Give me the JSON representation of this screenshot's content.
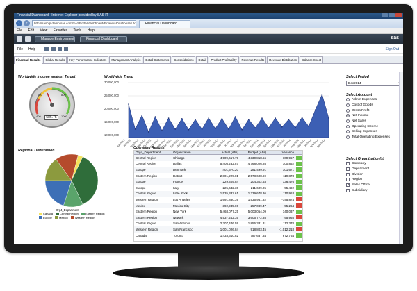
{
  "browser": {
    "title": "Financial Dashboard - Internet Explorer provided by SAS IT",
    "url": "http://sasbip.demo.sas.com/SASPortal/dashboard/FinancialDashboard.do",
    "tab_label": "Financial Dashboard",
    "menu": [
      "File",
      "Edit",
      "View",
      "Favorites",
      "Tools",
      "Help"
    ]
  },
  "sasbar": {
    "env_label": "Manage Environment",
    "dash_label": "Financial Dashboard",
    "logo": "sas"
  },
  "filebar": {
    "file": "File",
    "help": "Help",
    "signout": "Sign Out"
  },
  "tabs": [
    "Financial Results",
    "Global Results",
    "Key Performance Indicators",
    "Management Analysis",
    "Detail Statements",
    "Consolidations",
    "Detail",
    "Product Profitability",
    "Revenue Results",
    "Revenue Distribution",
    "Balance Sheet"
  ],
  "gauge": {
    "title": "Worldwide Income against Target",
    "value": "586.75",
    "labels": [
      "400",
      "600",
      "800",
      "1000"
    ]
  },
  "trend": {
    "title": "Worldwide Trend"
  },
  "chart_data": [
    {
      "type": "area",
      "title": "Worldwide Trend",
      "x": [
        "Jun2012",
        "Jul2012",
        "Aug2012",
        "Sep2012",
        "Oct2012",
        "Nov2012",
        "Dec2012",
        "Jan2013",
        "Feb2013",
        "Mar2013",
        "Apr2013",
        "May2013",
        "Jun2013",
        "Jul2013",
        "Aug2013",
        "Sep2013",
        "Oct2013",
        "Nov2013",
        "Dec2013",
        "Jan2014",
        "Feb2014",
        "Mar2014",
        "Apr2014",
        "May2014",
        "Jun2014",
        "Jul2014",
        "Aug2014",
        "Sep2014",
        "Oct2014",
        "Nov2014",
        "Dec2014"
      ],
      "values": [
        22000000,
        13000000,
        18000000,
        12000000,
        17500000,
        12500000,
        17000000,
        13000000,
        16800000,
        12800000,
        16500000,
        13000000,
        17000000,
        13200000,
        16800000,
        13000000,
        17500000,
        12800000,
        16500000,
        13500000,
        17000000,
        13500000,
        17000000,
        13800000,
        16500000,
        13600000,
        17200000,
        14000000,
        20000000,
        25500000,
        17000000
      ],
      "ylim": [
        10000000,
        30000000
      ],
      "yticks": [
        "30,000,000",
        "25,000,000",
        "20,000,000",
        "15,000,000",
        "10,000,000"
      ]
    },
    {
      "type": "pie",
      "title": "Regional Distribution",
      "legend_title": "Org4_Department",
      "slices": [
        {
          "name": "Canada",
          "value": 3
        },
        {
          "name": "Central Region",
          "value": 36
        },
        {
          "name": "Eastern Region",
          "value": 12
        },
        {
          "name": "Europe",
          "value": 20
        },
        {
          "name": "Mexico",
          "value": 15
        },
        {
          "name": "Western Region",
          "value": 14
        }
      ]
    }
  ],
  "pie": {
    "title": "Regional Distribution",
    "legend_title": "Org4_Department",
    "legend": [
      "Canada",
      "Central Region",
      "Eastern Region",
      "Europe",
      "Mexico",
      "Western Region"
    ]
  },
  "ops": {
    "title": "Operating Results",
    "headers": [
      "Org4_Department",
      "Organization",
      "Actual (Abs)",
      "Budget (Abs)",
      "Variance"
    ],
    "rows": [
      [
        "Central Region",
        "Chicago",
        "4,909,617.79",
        "4,330,818.56",
        "109,957"
      ],
      [
        "Central Region",
        "Dallas",
        "5,408,232.87",
        "4,768,026.85",
        "100,852"
      ],
      [
        "Europe",
        "Denmark",
        "401,370.20",
        "281,499.91",
        "101,671"
      ],
      [
        "Eastern Region",
        "Detroit",
        "2,801,229.81",
        "2,578,608.69",
        "119,873"
      ],
      [
        "Europe",
        "France",
        "229,405.84",
        "204,302.53",
        "136,476"
      ],
      [
        "Europe",
        "Italy",
        "225,642.30",
        "211,609.05",
        "95,492"
      ],
      [
        "Central Region",
        "Little Rock",
        "1,535,332.61",
        "1,239,678.36",
        "110,963"
      ],
      [
        "Western Region",
        "Los Angeles",
        "1,691,880.39",
        "1,535,961.32",
        "-145,874"
      ],
      [
        "Mexico",
        "Mexico City",
        "392,935.06",
        "257,089.47",
        "-95,264"
      ],
      [
        "Eastern Region",
        "New York",
        "5,468,077.25",
        "5,003,054.09",
        "140,037"
      ],
      [
        "Eastern Region",
        "Newark",
        "4,537,242.35",
        "3,606,772.35",
        "-95,955"
      ],
      [
        "Central Region",
        "San Antonio",
        "2,307,446.59",
        "1,856,331.31",
        "112,378"
      ],
      [
        "Western Region",
        "San Francisco",
        "1,001,026.84",
        "918,803.45",
        "-1,012,218"
      ],
      [
        "Canada",
        "Toronto",
        "1,433,610.82",
        "787,637.34",
        "672,764"
      ]
    ]
  },
  "period": {
    "title": "Select Period",
    "value": "Dec2014"
  },
  "account": {
    "title": "Select Account",
    "items": [
      "Admin Expenses",
      "Cost of Goods",
      "Gross Profit",
      "Net Income",
      "Net Sales",
      "Operating Income",
      "Selling Expenses",
      "Total Operating Expenses"
    ],
    "selected": "Net Income"
  },
  "orgs": {
    "title": "Select Organization(s)",
    "items": [
      "Company",
      "Department",
      "Division",
      "Region",
      "Sales Office",
      "Subsidiary"
    ],
    "checked": "Sales Office"
  },
  "colors": {
    "trend_fill": "#3c5fb4",
    "pie_canada": "#f5e35c",
    "pie_central": "#2f6d3a",
    "pie_eastern": "#5aa46b",
    "pie_europe": "#3d6fb6",
    "pie_mexico": "#8c9a3e",
    "pie_western": "#b54b2c",
    "good": "#6cc24a",
    "bad": "#d9473c"
  }
}
